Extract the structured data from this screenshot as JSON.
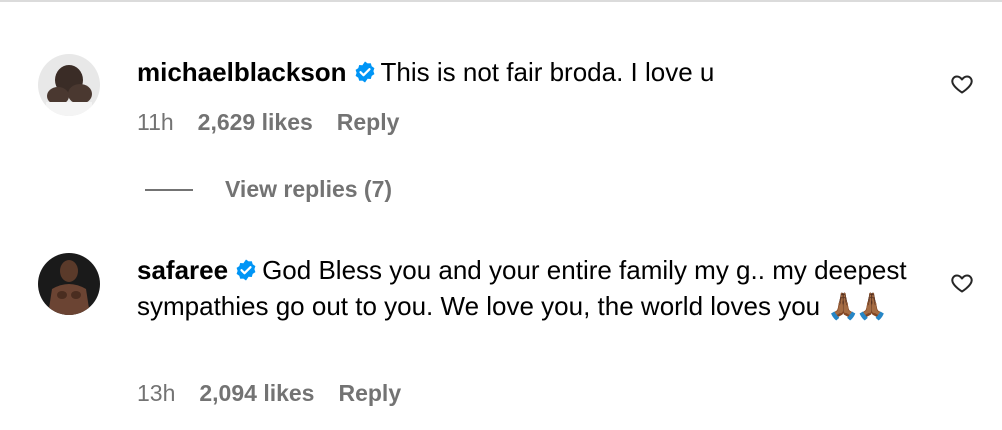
{
  "comments": [
    {
      "username": "michaelblackson",
      "text": "This is not fair broda. I love u",
      "time": "11h",
      "likes": "2,629 likes",
      "reply_label": "Reply",
      "view_replies": "View replies (7)"
    },
    {
      "username": "safaree",
      "text": "God Bless you and your entire family my g.. my deepest sympathies go out to you. We love you, the world loves you",
      "emoji": "🙏🏾🙏🏾",
      "time": "13h",
      "likes": "2,094 likes",
      "reply_label": "Reply"
    }
  ],
  "colors": {
    "verified_blue": "#0095f6",
    "meta_gray": "#737373"
  },
  "icons": {
    "verified": "verified-badge-icon",
    "like": "heart-outline-icon"
  }
}
